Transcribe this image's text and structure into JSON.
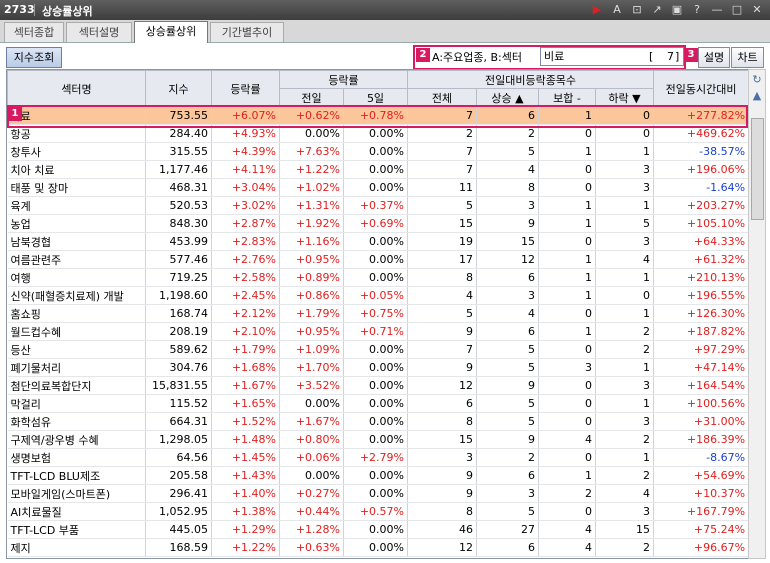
{
  "window": {
    "code": "2733",
    "title": "상승률상위"
  },
  "tabs": [
    {
      "label": "섹터종합"
    },
    {
      "label": "섹터설명"
    },
    {
      "label": "상승률상위"
    },
    {
      "label": "기간별추이"
    }
  ],
  "toolbar": {
    "index_button": "지수조회",
    "filter_label": "A:주요업종, B:섹터",
    "filter_value": "비료",
    "filter_bracket_open": "[",
    "filter_count": "7",
    "filter_bracket_close": "]",
    "desc_button": "설명",
    "chart_button": "차트"
  },
  "badges": {
    "row": "1",
    "filter": "2",
    "desc": "3"
  },
  "columns": {
    "sector": "섹터명",
    "index": "지수",
    "rate": "등락률",
    "rate_group": "등락률",
    "prev_day": "전일",
    "five_day": "5일",
    "count_group": "전일대비등락종목수",
    "total": "전체",
    "rise": "상승 ▲",
    "flat": "보합 -",
    "fall": "하락 ▼",
    "same_time": "전일동시간대비"
  },
  "colors": {
    "up": "#e02020",
    "down": "#1a3fcf",
    "selected": "#fbc79a"
  },
  "rows": [
    {
      "name": "비료",
      "index": "753.55",
      "rate": "+6.07%",
      "prev": "+0.62%",
      "d5": "+0.78%",
      "total": "7",
      "rise": "6",
      "flat": "1",
      "fall": "0",
      "st": "+277.82%"
    },
    {
      "name": "항공",
      "index": "284.40",
      "rate": "+4.93%",
      "prev": "0.00%",
      "d5": "0.00%",
      "total": "2",
      "rise": "2",
      "flat": "0",
      "fall": "0",
      "st": "+469.62%"
    },
    {
      "name": "창투사",
      "index": "315.55",
      "rate": "+4.39%",
      "prev": "+7.63%",
      "d5": "0.00%",
      "total": "7",
      "rise": "5",
      "flat": "1",
      "fall": "1",
      "st": "-38.57%"
    },
    {
      "name": "치아 치료",
      "index": "1,177.46",
      "rate": "+4.11%",
      "prev": "+1.22%",
      "d5": "0.00%",
      "total": "7",
      "rise": "4",
      "flat": "0",
      "fall": "3",
      "st": "+196.06%"
    },
    {
      "name": "태풍 및 장마",
      "index": "468.31",
      "rate": "+3.04%",
      "prev": "+1.02%",
      "d5": "0.00%",
      "total": "11",
      "rise": "8",
      "flat": "0",
      "fall": "3",
      "st": "-1.64%"
    },
    {
      "name": "육계",
      "index": "520.53",
      "rate": "+3.02%",
      "prev": "+1.31%",
      "d5": "+0.37%",
      "total": "5",
      "rise": "3",
      "flat": "1",
      "fall": "1",
      "st": "+203.27%"
    },
    {
      "name": "농업",
      "index": "848.30",
      "rate": "+2.87%",
      "prev": "+1.92%",
      "d5": "+0.69%",
      "total": "15",
      "rise": "9",
      "flat": "1",
      "fall": "5",
      "st": "+105.10%"
    },
    {
      "name": "남북경협",
      "index": "453.99",
      "rate": "+2.83%",
      "prev": "+1.16%",
      "d5": "0.00%",
      "total": "19",
      "rise": "15",
      "flat": "0",
      "fall": "3",
      "st": "+64.33%"
    },
    {
      "name": "여름관련주",
      "index": "577.46",
      "rate": "+2.76%",
      "prev": "+0.95%",
      "d5": "0.00%",
      "total": "17",
      "rise": "12",
      "flat": "1",
      "fall": "4",
      "st": "+61.32%"
    },
    {
      "name": "여행",
      "index": "719.25",
      "rate": "+2.58%",
      "prev": "+0.89%",
      "d5": "0.00%",
      "total": "8",
      "rise": "6",
      "flat": "1",
      "fall": "1",
      "st": "+210.13%"
    },
    {
      "name": "신약(패혈증치료제) 개발",
      "index": "1,198.60",
      "rate": "+2.45%",
      "prev": "+0.86%",
      "d5": "+0.05%",
      "total": "4",
      "rise": "3",
      "flat": "1",
      "fall": "0",
      "st": "+196.55%"
    },
    {
      "name": "홈쇼핑",
      "index": "168.74",
      "rate": "+2.12%",
      "prev": "+1.79%",
      "d5": "+0.75%",
      "total": "5",
      "rise": "4",
      "flat": "0",
      "fall": "1",
      "st": "+126.30%"
    },
    {
      "name": "월드컵수혜",
      "index": "208.19",
      "rate": "+2.10%",
      "prev": "+0.95%",
      "d5": "+0.71%",
      "total": "9",
      "rise": "6",
      "flat": "1",
      "fall": "2",
      "st": "+187.82%"
    },
    {
      "name": "등산",
      "index": "589.62",
      "rate": "+1.79%",
      "prev": "+1.09%",
      "d5": "0.00%",
      "total": "7",
      "rise": "5",
      "flat": "0",
      "fall": "2",
      "st": "+97.29%"
    },
    {
      "name": "폐기물처리",
      "index": "304.76",
      "rate": "+1.68%",
      "prev": "+1.70%",
      "d5": "0.00%",
      "total": "9",
      "rise": "5",
      "flat": "3",
      "fall": "1",
      "st": "+47.14%"
    },
    {
      "name": "첨단의료복합단지",
      "index": "15,831.55",
      "rate": "+1.67%",
      "prev": "+3.52%",
      "d5": "0.00%",
      "total": "12",
      "rise": "9",
      "flat": "0",
      "fall": "3",
      "st": "+164.54%"
    },
    {
      "name": "막걸리",
      "index": "115.52",
      "rate": "+1.65%",
      "prev": "0.00%",
      "d5": "0.00%",
      "total": "6",
      "rise": "5",
      "flat": "0",
      "fall": "1",
      "st": "+100.56%"
    },
    {
      "name": "화학섬유",
      "index": "664.31",
      "rate": "+1.52%",
      "prev": "+1.67%",
      "d5": "0.00%",
      "total": "8",
      "rise": "5",
      "flat": "0",
      "fall": "3",
      "st": "+31.00%"
    },
    {
      "name": "구제역/광우병 수혜",
      "index": "1,298.05",
      "rate": "+1.48%",
      "prev": "+0.80%",
      "d5": "0.00%",
      "total": "15",
      "rise": "9",
      "flat": "4",
      "fall": "2",
      "st": "+186.39%"
    },
    {
      "name": "생명보험",
      "index": "64.56",
      "rate": "+1.45%",
      "prev": "+0.06%",
      "d5": "+2.79%",
      "total": "3",
      "rise": "2",
      "flat": "0",
      "fall": "1",
      "st": "-8.67%"
    },
    {
      "name": "TFT-LCD BLU제조",
      "index": "205.58",
      "rate": "+1.43%",
      "prev": "0.00%",
      "d5": "0.00%",
      "total": "9",
      "rise": "6",
      "flat": "1",
      "fall": "2",
      "st": "+54.69%"
    },
    {
      "name": "모바일게임(스마트폰)",
      "index": "296.41",
      "rate": "+1.40%",
      "prev": "+0.27%",
      "d5": "0.00%",
      "total": "9",
      "rise": "3",
      "flat": "2",
      "fall": "4",
      "st": "+10.37%"
    },
    {
      "name": "AI치료물질",
      "index": "1,052.95",
      "rate": "+1.38%",
      "prev": "+0.44%",
      "d5": "+0.57%",
      "total": "8",
      "rise": "5",
      "flat": "0",
      "fall": "3",
      "st": "+167.79%"
    },
    {
      "name": "TFT-LCD 부품",
      "index": "445.05",
      "rate": "+1.29%",
      "prev": "+1.28%",
      "d5": "0.00%",
      "total": "46",
      "rise": "27",
      "flat": "4",
      "fall": "15",
      "st": "+75.24%"
    },
    {
      "name": "제지",
      "index": "168.59",
      "rate": "+1.22%",
      "prev": "+0.63%",
      "d5": "0.00%",
      "total": "12",
      "rise": "6",
      "flat": "4",
      "fall": "2",
      "st": "+96.67%"
    }
  ]
}
